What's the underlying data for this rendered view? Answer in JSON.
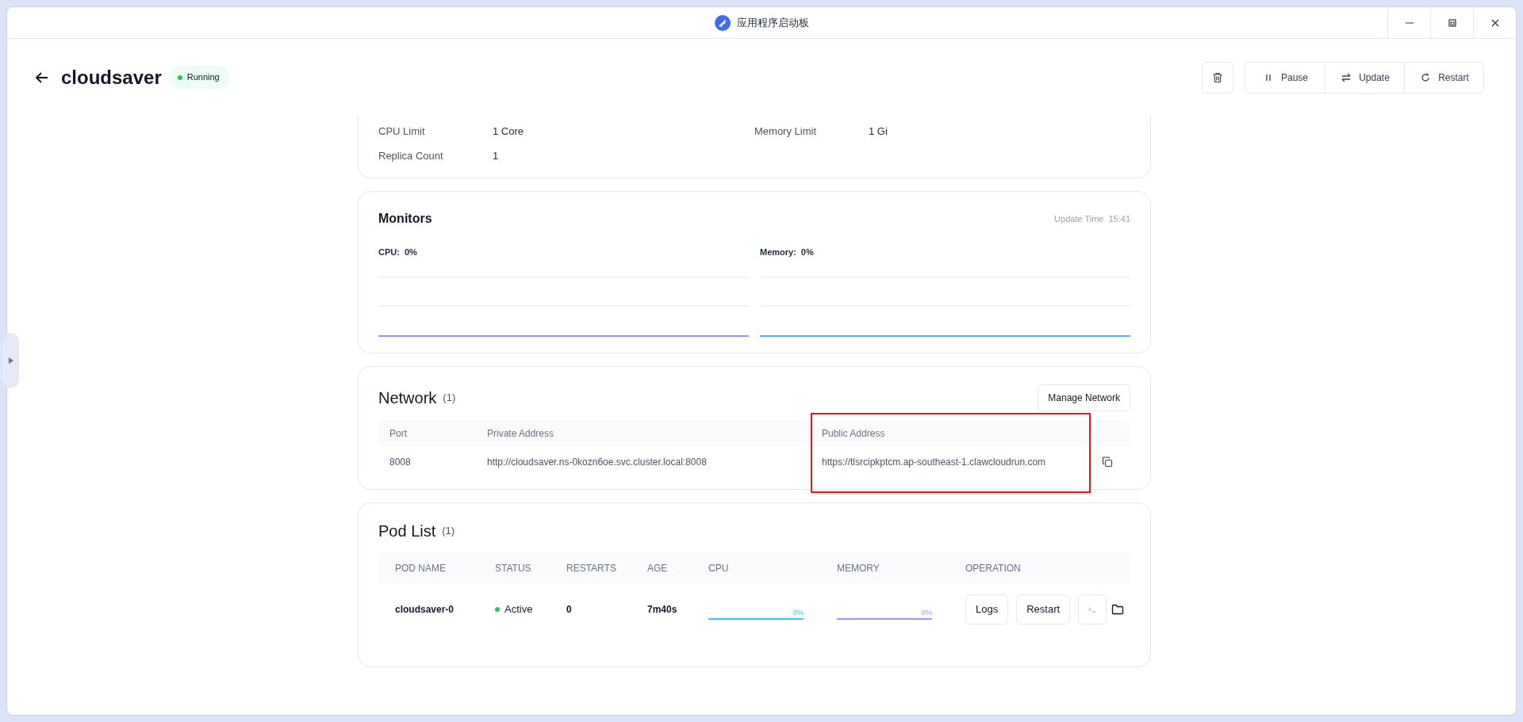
{
  "window": {
    "title": "应用程序启动板"
  },
  "app": {
    "name": "cloudsaver",
    "status": {
      "label": "Running",
      "color": "#22c55e"
    }
  },
  "actions": [
    "Pause",
    "Update",
    "Restart"
  ],
  "config": {
    "rows": [
      [
        {
          "label": "CPU Limit",
          "value": "1 Core"
        },
        {
          "label": "Memory Limit",
          "value": "1 Gi"
        }
      ],
      [
        {
          "label": "Replica Count",
          "value": "1"
        }
      ]
    ]
  },
  "monitors": {
    "title": "Monitors",
    "update_label": "Update Time",
    "update_time": "15:41",
    "charts": [
      {
        "label": "CPU:",
        "value": "0%",
        "color": "#a78bfa"
      },
      {
        "label": "Memory:",
        "value": "0%",
        "color": "#60a5fa"
      }
    ]
  },
  "network": {
    "title": "Network",
    "count": "(1)",
    "button": "Manage Network",
    "public_highlighted": true,
    "columns": [
      "Port",
      "Private Address",
      "Public Address"
    ],
    "rows": [
      {
        "port": "8008",
        "private_address": "http://cloudsaver.ns-0kozn6oe.svc.cluster.local:8008",
        "public_address": "https://tlsrcipkptcm.ap-southeast-1.clawcloudrun.com"
      }
    ]
  },
  "pods": {
    "title": "Pod List",
    "count": "(1)",
    "columns": [
      "POD NAME",
      "STATUS",
      "RESTARTS",
      "AGE",
      "CPU",
      "MEMORY",
      "OPERATION"
    ],
    "rows": [
      {
        "name": "cloudsaver-0",
        "status": {
          "label": "Active",
          "color": "#22c55e"
        },
        "restarts": "0",
        "age": "7m40s",
        "cpu": {
          "value": "0%",
          "color": "#38bdf8"
        },
        "memory": {
          "value": "0%",
          "color": "#a78bfa"
        },
        "buttons": [
          "Logs",
          "Restart"
        ]
      }
    ]
  }
}
